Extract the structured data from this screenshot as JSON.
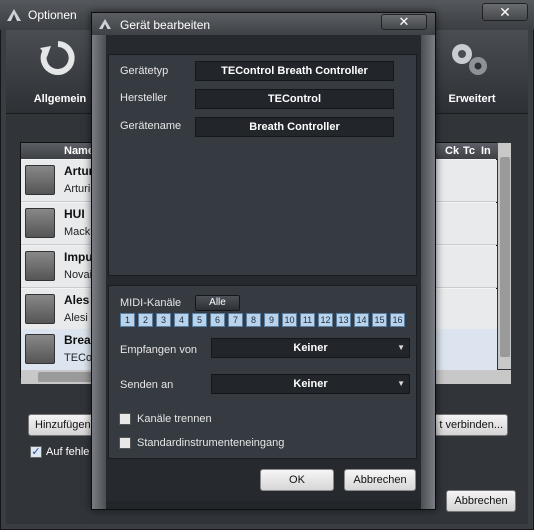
{
  "options_window": {
    "title": "Optionen",
    "close_glyph": "✕",
    "toolbar": {
      "general_label": "Allgemein",
      "general_icon": "refresh-icon",
      "advanced_label": "Erweitert",
      "advanced_icon": "gears-icon"
    },
    "device_list": {
      "columns": {
        "name": "Name",
        "ck": "Ck",
        "tc": "Tc",
        "in": "In"
      },
      "rows": [
        {
          "name": "Artur",
          "sub": "Arturi",
          "icon": "keyboard-icon"
        },
        {
          "name": "HUI",
          "sub": "Macki",
          "icon": "fader-icon"
        },
        {
          "name": "Impu",
          "sub": "Novai",
          "icon": "keyboard-warning-icon"
        },
        {
          "name": "Ales",
          "sub": "Alesi",
          "icon": "keyboard-icon"
        },
        {
          "name": "Brea",
          "sub": "TECo",
          "icon": "keyboard-icon"
        }
      ]
    },
    "add_button": "Hinzufügen",
    "connect_button": "t verbinden...",
    "auto_checkbox_label": "Auf fehle",
    "cancel_button": "Abbrechen"
  },
  "dialog": {
    "title": "Gerät bearbeiten",
    "close_glyph": "✕",
    "device_type_label": "Gerätetyp",
    "device_type_value": "TEControl Breath Controller",
    "manufacturer_label": "Hersteller",
    "manufacturer_value": "TEControl",
    "device_name_label": "Gerätename",
    "device_name_value": "Breath Controller",
    "midi_channels_label": "MIDI-Kanäle",
    "all_button": "Alle",
    "channels": [
      "1",
      "2",
      "3",
      "4",
      "5",
      "6",
      "7",
      "8",
      "9",
      "10",
      "11",
      "12",
      "13",
      "14",
      "15",
      "16"
    ],
    "receive_from_label": "Empfangen von",
    "receive_from_value": "Keiner",
    "send_to_label": "Senden an",
    "send_to_value": "Keiner",
    "split_channels_label": "Kanäle trennen",
    "standard_input_label": "Standardinstrumenteneingang",
    "ok_button": "OK",
    "cancel_button": "Abbrechen"
  }
}
